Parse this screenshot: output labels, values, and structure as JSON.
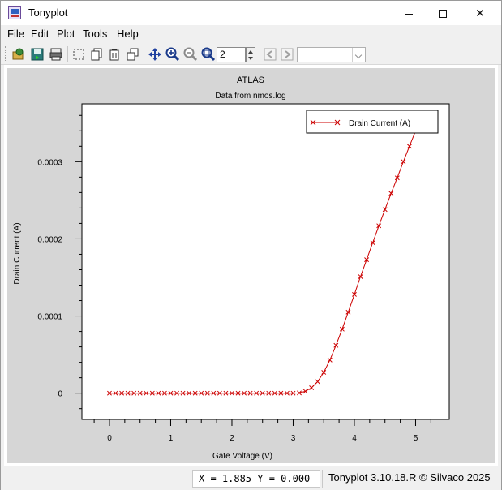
{
  "window": {
    "title": "Tonyplot",
    "controls": {
      "minimize": "minimize-icon",
      "maximize": "maximize-icon",
      "close": "close-icon"
    }
  },
  "menu": [
    "File",
    "Edit",
    "Plot",
    "Tools",
    "Help"
  ],
  "toolbar": {
    "icons": [
      "open-icon",
      "save-icon",
      "print-icon",
      "select-icon",
      "copy-icon",
      "delete-icon",
      "duplicate-icon",
      "pan-icon",
      "zoom-in-icon",
      "zoom-out-icon",
      "zoom-fit-icon",
      "back-icon",
      "forward-icon"
    ],
    "zoom_value": "2",
    "combo_value": ""
  },
  "chart_data": {
    "type": "line",
    "title": "ATLAS",
    "subtitle": "Data from nmos.log",
    "xlabel": "Gate Voltage (V)",
    "ylabel": "Drain Current (A)",
    "xlim": [
      -0.45,
      5.55
    ],
    "ylim": [
      -3.4e-05,
      0.000375
    ],
    "x_ticks": [
      0,
      1,
      2,
      3,
      4,
      5
    ],
    "x_tick_labels": [
      "0",
      "1",
      "2",
      "3",
      "4",
      "5"
    ],
    "y_ticks": [
      0,
      0.0001,
      0.0002,
      0.0003
    ],
    "y_tick_labels": [
      "0",
      "0.0001",
      "0.0002",
      "0.0003"
    ],
    "legend_position": "top-right",
    "grid": false,
    "series": [
      {
        "name": "Drain Current (A)",
        "color": "#cc0000",
        "marker": "x",
        "x": [
          0,
          0.1,
          0.2,
          0.3,
          0.4,
          0.5,
          0.6,
          0.7,
          0.8,
          0.9,
          1.0,
          1.1,
          1.2,
          1.3,
          1.4,
          1.5,
          1.6,
          1.7,
          1.8,
          1.9,
          2.0,
          2.1,
          2.2,
          2.3,
          2.4,
          2.5,
          2.6,
          2.7,
          2.8,
          2.9,
          3.0,
          3.1,
          3.2,
          3.3,
          3.4,
          3.5,
          3.6,
          3.7,
          3.8,
          3.9,
          4.0,
          4.1,
          4.2,
          4.3,
          4.4,
          4.5,
          4.6,
          4.7,
          4.8,
          4.9,
          5.0
        ],
        "y": [
          0,
          0,
          0,
          0,
          0,
          0,
          0,
          0,
          0,
          0,
          0,
          0,
          0,
          0,
          0,
          0,
          0,
          0,
          0,
          0,
          0,
          0,
          0,
          0,
          0,
          0,
          0,
          0,
          0,
          0,
          0,
          3e-07,
          2.5e-06,
          7e-06,
          1.5e-05,
          2.7e-05,
          4.3e-05,
          6.2e-05,
          8.3e-05,
          0.000105,
          0.000128,
          0.000151,
          0.000173,
          0.000195,
          0.000217,
          0.000238,
          0.000259,
          0.000279,
          0.0003,
          0.00032,
          0.00034
        ]
      }
    ]
  },
  "status": {
    "coords": "X = 1.885 Y = 0.000",
    "version": "Tonyplot 3.10.18.R © Silvaco 2025"
  }
}
